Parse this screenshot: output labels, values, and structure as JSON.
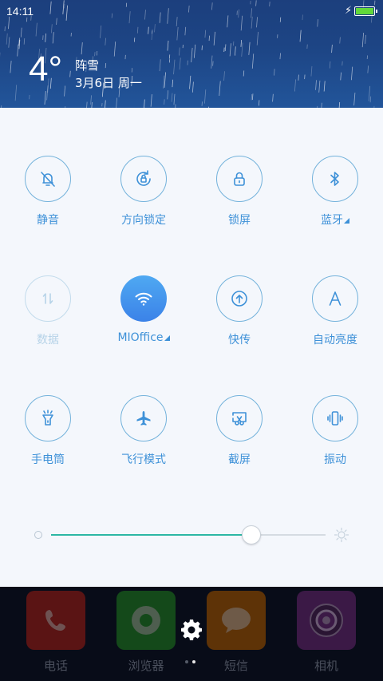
{
  "status_bar": {
    "time": "14:11",
    "battery_percent": 100,
    "charging": true
  },
  "weather": {
    "temperature": "4°",
    "condition": "阵雪",
    "date": "3月6日 周一"
  },
  "toggles": [
    {
      "label": "静音",
      "icon": "bell-off-icon",
      "state": "off"
    },
    {
      "label": "方向锁定",
      "icon": "rotation-lock-icon",
      "state": "off"
    },
    {
      "label": "锁屏",
      "icon": "lock-icon",
      "state": "off"
    },
    {
      "label": "蓝牙",
      "icon": "bluetooth-icon",
      "state": "off",
      "has_menu": true
    },
    {
      "label": "数据",
      "icon": "mobile-data-icon",
      "state": "disabled"
    },
    {
      "label": "MIOffice",
      "icon": "wifi-icon",
      "state": "on",
      "has_menu": true
    },
    {
      "label": "快传",
      "icon": "quick-transfer-icon",
      "state": "off"
    },
    {
      "label": "自动亮度",
      "icon": "auto-brightness-icon",
      "state": "off"
    },
    {
      "label": "手电筒",
      "icon": "flashlight-icon",
      "state": "off"
    },
    {
      "label": "飞行模式",
      "icon": "airplane-icon",
      "state": "off"
    },
    {
      "label": "截屏",
      "icon": "screenshot-icon",
      "state": "off"
    },
    {
      "label": "振动",
      "icon": "vibrate-icon",
      "state": "off"
    }
  ],
  "brightness": {
    "level": 0.73
  },
  "dock": {
    "apps": [
      {
        "label": "电话",
        "icon": "phone-icon",
        "color": "#5a1414"
      },
      {
        "label": "浏览器",
        "icon": "browser-icon",
        "color": "#14491a"
      },
      {
        "label": "短信",
        "icon": "message-icon",
        "color": "#5e3307"
      },
      {
        "label": "相机",
        "icon": "camera-icon",
        "color": "#3b1946"
      }
    ],
    "page_indicator": {
      "pages": 2,
      "current": 2
    }
  },
  "colors": {
    "accent": "#3e91d8",
    "active_toggle": "#3b82e8",
    "slider_fill": "#2cb7a4"
  }
}
